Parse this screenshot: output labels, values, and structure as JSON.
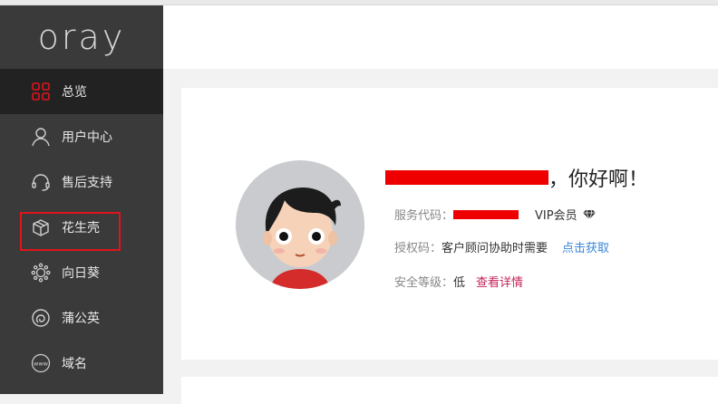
{
  "brand": {
    "logo_text": "oray"
  },
  "sidebar": {
    "items": [
      {
        "label": "总览",
        "icon": "dashboard-grid-icon",
        "active": true
      },
      {
        "label": "用户中心",
        "icon": "user-icon"
      },
      {
        "label": "售后支持",
        "icon": "headset-icon"
      },
      {
        "label": "花生壳",
        "icon": "box-icon",
        "highlighted": true
      },
      {
        "label": "向日葵",
        "icon": "sunflower-icon"
      },
      {
        "label": "蒲公英",
        "icon": "dandelion-icon"
      },
      {
        "label": "域名",
        "icon": "www-icon"
      }
    ]
  },
  "profile": {
    "greeting_suffix": "，你好啊！",
    "service_code_label": "服务代码：",
    "vip_label": "VIP会员",
    "auth_code_label": "授权码：",
    "auth_code_value": "客户顾问协助时需要",
    "auth_code_link": "点击获取",
    "security_label": "安全等级：",
    "security_value": "低",
    "security_link": "查看详情"
  },
  "colors": {
    "sidebar_bg": "#3a3a3a",
    "sidebar_active_bg": "#222222",
    "highlight_border": "#e0141b",
    "link_blue": "#3a87d6",
    "link_red": "#c7225a",
    "redaction": "#ee0000"
  }
}
